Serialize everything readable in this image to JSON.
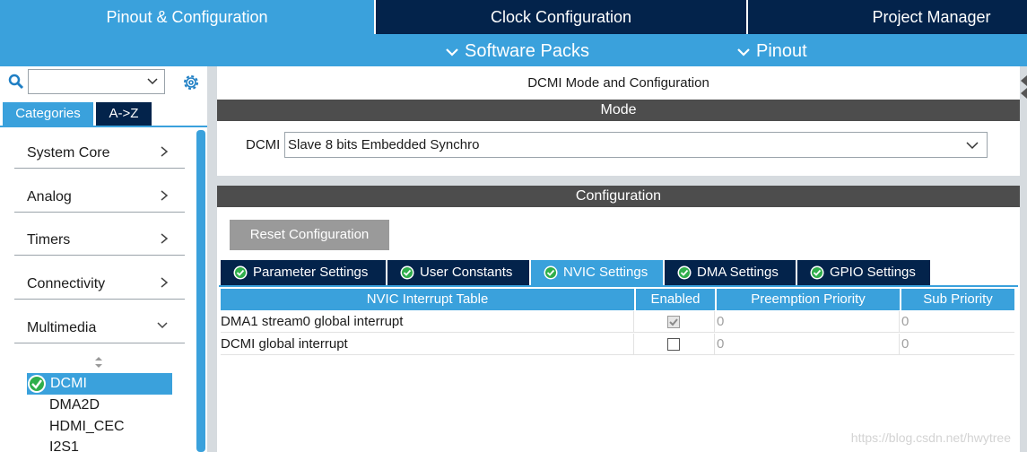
{
  "top_tabs": [
    "Pinout & Configuration",
    "Clock Configuration",
    "Project Manager"
  ],
  "sub_menu": [
    "Software Packs",
    "Pinout"
  ],
  "left_panel": {
    "search_value": "",
    "tabs": [
      "Categories",
      "A->Z"
    ],
    "categories": [
      "System Core",
      "Analog",
      "Timers",
      "Connectivity",
      "Multimedia"
    ],
    "multimedia_items": [
      "DCMI",
      "DMA2D",
      "HDMI_CEC",
      "I2S1"
    ],
    "selected_item": "DCMI"
  },
  "main": {
    "title": "DCMI Mode and Configuration",
    "mode_header": "Mode",
    "dcmi_label": "DCMI",
    "dcmi_mode": "Slave 8 bits Embedded Synchro",
    "config_header": "Configuration",
    "reset_button": "Reset Configuration",
    "config_tabs": [
      "Parameter Settings",
      "User Constants",
      "NVIC Settings",
      "DMA Settings",
      "GPIO Settings"
    ],
    "active_tab": "NVIC Settings",
    "table": {
      "headers": [
        "NVIC Interrupt Table",
        "Enabled",
        "Preemption Priority",
        "Sub Priority"
      ],
      "rows": [
        {
          "name": "DMA1 stream0 global interrupt",
          "enabled": true,
          "preemption": "0",
          "sub": "0"
        },
        {
          "name": "DCMI global interrupt",
          "enabled": false,
          "preemption": "0",
          "sub": "0"
        }
      ]
    }
  },
  "watermark": "https://blog.csdn.net/hwytree",
  "colors": {
    "navy": "#03234b",
    "accent": "#3aa1dc",
    "header_grey": "#4d4d4d",
    "ok_green": "#2fae4b"
  }
}
